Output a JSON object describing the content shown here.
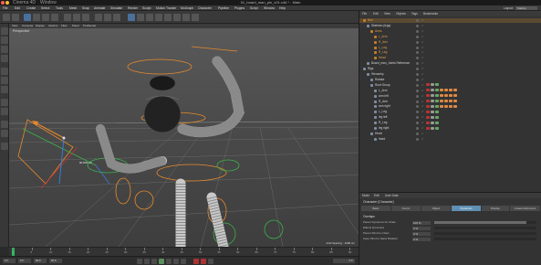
{
  "app": {
    "menu": [
      "Cinema 4D",
      "Window"
    ],
    "document_title": "01_board_man_pin_v01.c4d * - Main"
  },
  "menubar": {
    "items": [
      "File",
      "Edit",
      "Create",
      "Select",
      "Tools",
      "Mesh",
      "Snap",
      "Animate",
      "Simulate",
      "Render",
      "Sculpt",
      "Motion Tracker",
      "MoGraph",
      "Character",
      "Pipeline",
      "Plugins",
      "Script",
      "Window",
      "Help"
    ],
    "layout_label": "Layout:",
    "layout_value": "Startup"
  },
  "viewport": {
    "menu": [
      "View",
      "Cameras",
      "Display",
      "Options",
      "Filter",
      "Panel",
      "ProRender"
    ],
    "label": "Perspective",
    "grid_spacing": "Grid Spacing : 1000 cm",
    "measure": "90.833 cm",
    "colors": {
      "accent": "#e07a2a",
      "grid": "#666666"
    }
  },
  "timeline": {
    "ticks": [
      "0",
      "5",
      "10",
      "15",
      "20",
      "25",
      "30",
      "35",
      "40",
      "45",
      "50",
      "55",
      "60",
      "65",
      "70",
      "75",
      "80",
      "85",
      "90"
    ],
    "frame_start": "0 F",
    "frame_field": "0 F",
    "frame_end": "90 F",
    "frame_end2": "90 F",
    "current": "0 F"
  },
  "object_manager": {
    "menu": [
      "File",
      "Edit",
      "View",
      "Objects",
      "Tags",
      "Bookmarks"
    ],
    "rows": [
      {
        "label": "Null",
        "indent": 0,
        "color": "orange",
        "selected": true
      },
      {
        "label": "Skeleton (legs)",
        "indent": 1,
        "color": "white",
        "selected": false
      },
      {
        "label": "Arms",
        "indent": 2,
        "color": "orange",
        "selected": false
      },
      {
        "label": "L_Arm",
        "indent": 3,
        "color": "orange",
        "selected": false
      },
      {
        "label": "R_Arm",
        "indent": 3,
        "color": "orange",
        "selected": false
      },
      {
        "label": "L_Leg",
        "indent": 3,
        "color": "orange",
        "selected": false
      },
      {
        "label": "R_Leg",
        "indent": 3,
        "color": "orange",
        "selected": false
      },
      {
        "label": "Head",
        "indent": 3,
        "color": "orange",
        "selected": false
      },
      {
        "label": "Board_man_Joints Reference",
        "indent": 1,
        "color": "white",
        "selected": false
      },
      {
        "label": "Rigs",
        "indent": 0,
        "color": "white",
        "selected": false
      },
      {
        "label": "Hierarchy",
        "indent": 1,
        "color": "white",
        "selected": false
      },
      {
        "label": "Rotator",
        "indent": 2,
        "color": "white",
        "selected": false
      },
      {
        "label": "Root Group",
        "indent": 2,
        "color": "white",
        "selected": false
      },
      {
        "label": "L_Arm",
        "indent": 3,
        "color": "white",
        "selected": false
      },
      {
        "label": "arm left",
        "indent": 3,
        "color": "white",
        "selected": false
      },
      {
        "label": "R_Arm",
        "indent": 3,
        "color": "white",
        "selected": false
      },
      {
        "label": "arm right",
        "indent": 3,
        "color": "white",
        "selected": false
      },
      {
        "label": "L_Leg",
        "indent": 3,
        "color": "white",
        "selected": false
      },
      {
        "label": "leg left",
        "indent": 3,
        "color": "white",
        "selected": false
      },
      {
        "label": "R_Leg",
        "indent": 3,
        "color": "white",
        "selected": false
      },
      {
        "label": "leg right",
        "indent": 3,
        "color": "white",
        "selected": false
      },
      {
        "label": "Head",
        "indent": 2,
        "color": "white",
        "selected": false
      },
      {
        "label": "head",
        "indent": 3,
        "color": "white",
        "selected": false
      }
    ]
  },
  "attribute_manager": {
    "menu": [
      "Mode",
      "Edit",
      "User Data"
    ],
    "title": "Character [Character]",
    "tabs": [
      "Basic",
      "Coord.",
      "Object",
      "Dynamics",
      "Display",
      "Create Deformers"
    ],
    "active_tab": "Dynamics",
    "section": "Overlaps",
    "params": [
      {
        "label": "Parent Dynamics for Chain",
        "value": "100 %",
        "fill": 0.9
      },
      {
        "label": "Effects Dynamics",
        "value": "0 %",
        "fill": 0.0
      },
      {
        "label": "Parent Wind to Chain",
        "value": "0 %",
        "fill": 0.0
      },
      {
        "label": "Keep Wind to Hand Rotation",
        "value": "0 %",
        "fill": 0.0
      }
    ]
  }
}
